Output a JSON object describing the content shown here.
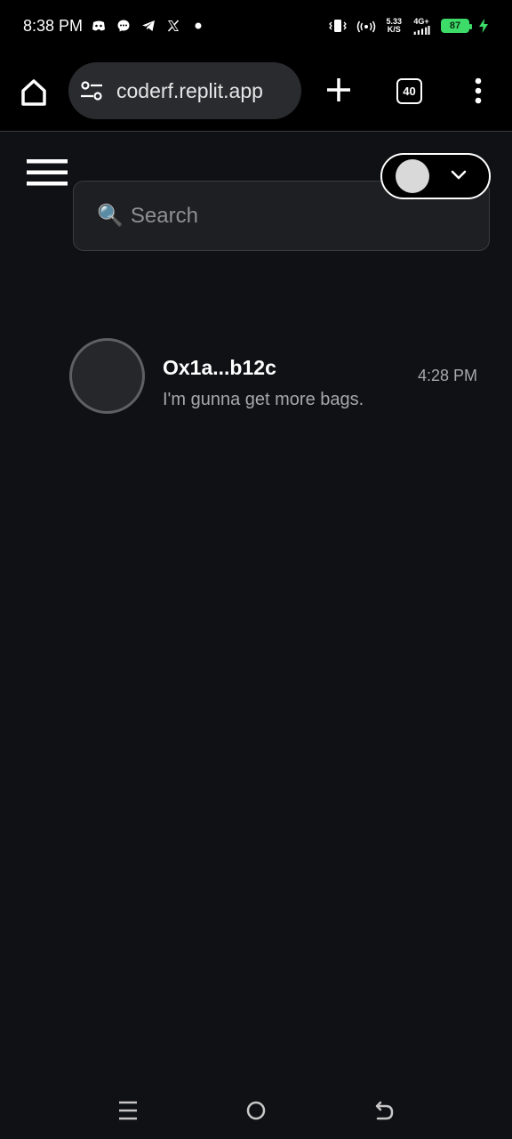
{
  "status_bar": {
    "time": "8:38 PM",
    "left_icons": [
      "discord-icon",
      "messenger-icon",
      "telegram-icon",
      "x-icon",
      "dot-icon"
    ],
    "right_icons": [
      "vibrate-icon",
      "hotspot-icon",
      "signal-icon",
      "battery-icon",
      "charging-icon"
    ],
    "net_speed_value": "5.33",
    "net_speed_unit": "K/S",
    "network_type": "4G+",
    "battery_level": "87",
    "battery_color": "#3ddc68"
  },
  "browser": {
    "url": "coderf.replit.app",
    "tab_count": "40"
  },
  "app": {
    "search": {
      "placeholder": "Search",
      "icon": "🔍"
    },
    "chats": [
      {
        "name": "Ox1a...b12c",
        "message": "I'm gunna get more bags.",
        "time": "4:28 PM"
      }
    ]
  },
  "nav_bar": {
    "icons": [
      "recent-apps-icon",
      "home-icon",
      "back-icon"
    ]
  },
  "colors": {
    "background": "#101114",
    "search_bg": "#1e1f23",
    "muted_text": "#a6a8ad"
  }
}
